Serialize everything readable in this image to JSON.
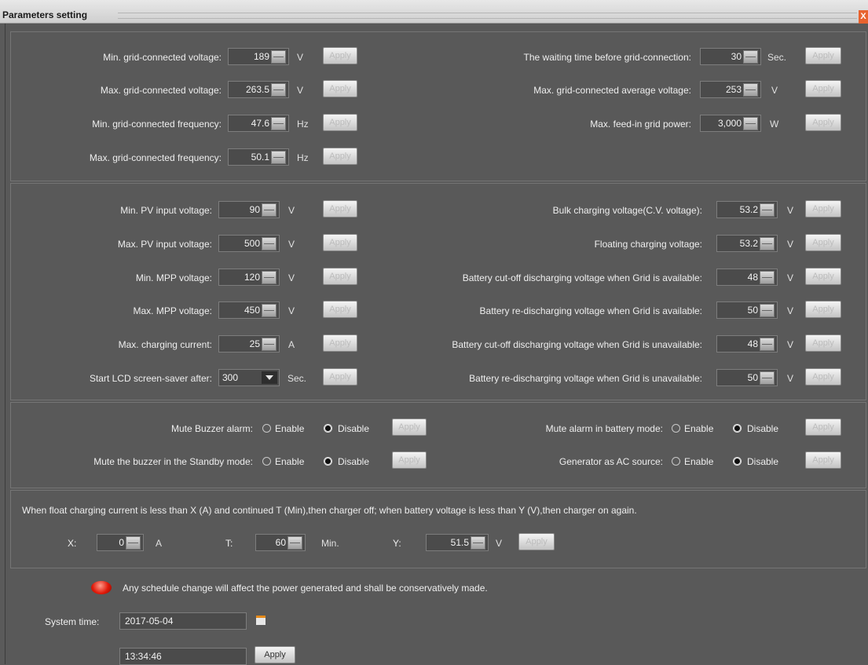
{
  "window": {
    "title": "Parameters setting",
    "close_label": "X"
  },
  "apply_label": "Apply",
  "grid": {
    "left": [
      {
        "label": "Min. grid-connected voltage:",
        "value": "189",
        "unit": "V"
      },
      {
        "label": "Max. grid-connected voltage:",
        "value": "263.5",
        "unit": "V"
      },
      {
        "label": "Min. grid-connected frequency:",
        "value": "47.6",
        "unit": "Hz"
      },
      {
        "label": "Max. grid-connected frequency:",
        "value": "50.1",
        "unit": "Hz"
      }
    ],
    "right": [
      {
        "label": "The waiting time before grid-connection:",
        "value": "30",
        "unit": "Sec."
      },
      {
        "label": "Max. grid-connected average voltage:",
        "value": "253",
        "unit": "V"
      },
      {
        "label": "Max. feed-in grid power:",
        "value": "3,000",
        "unit": "W"
      }
    ]
  },
  "pv": {
    "left": [
      {
        "label": "Min. PV input voltage:",
        "value": "90",
        "unit": "V"
      },
      {
        "label": "Max. PV input voltage:",
        "value": "500",
        "unit": "V"
      },
      {
        "label": "Min. MPP voltage:",
        "value": "120",
        "unit": "V"
      },
      {
        "label": "Max. MPP voltage:",
        "value": "450",
        "unit": "V"
      },
      {
        "label": "Max. charging current:",
        "value": "25",
        "unit": "A"
      }
    ],
    "screensaver": {
      "label": "Start LCD screen-saver after:",
      "value": "300",
      "unit": "Sec."
    },
    "right": [
      {
        "label": "Bulk charging voltage(C.V. voltage):",
        "value": "53.2",
        "unit": "V"
      },
      {
        "label": "Floating charging voltage:",
        "value": "53.2",
        "unit": "V"
      },
      {
        "label": "Battery cut-off discharging voltage when Grid is available:",
        "value": "48",
        "unit": "V"
      },
      {
        "label": "Battery re-discharging voltage when Grid is available:",
        "value": "50",
        "unit": "V"
      },
      {
        "label": "Battery cut-off discharging voltage when Grid is unavailable:",
        "value": "48",
        "unit": "V"
      },
      {
        "label": "Battery re-discharging voltage when Grid is unavailable:",
        "value": "50",
        "unit": "V"
      }
    ]
  },
  "alarms": {
    "enable_label": "Enable",
    "disable_label": "Disable",
    "items": [
      {
        "label": "Mute Buzzer alarm:",
        "selected": "Disable"
      },
      {
        "label": "Mute the buzzer in the Standby mode:",
        "selected": "Disable"
      },
      {
        "label": "Mute alarm in battery mode:",
        "selected": "Disable"
      },
      {
        "label": "Generator as AC source:",
        "selected": "Disable"
      }
    ]
  },
  "float_charge": {
    "description": "When float charging current is less than X (A) and continued T (Min),then charger off; when battery voltage is less than Y (V),then charger on again.",
    "x": {
      "label": "X:",
      "value": "0",
      "unit": "A"
    },
    "t": {
      "label": "T:",
      "value": "60",
      "unit": "Min."
    },
    "y": {
      "label": "Y:",
      "value": "51.5",
      "unit": "V"
    }
  },
  "schedule": {
    "warning": "Any schedule change will affect the power generated and shall be conservatively made.",
    "system_time_label": "System time:",
    "date": "2017-05-04",
    "time": "13:34:46"
  },
  "colors": {
    "background": "#5a5a5a",
    "warning_icon": "#e01a0a",
    "calendar_icon": "#e58a1a"
  }
}
